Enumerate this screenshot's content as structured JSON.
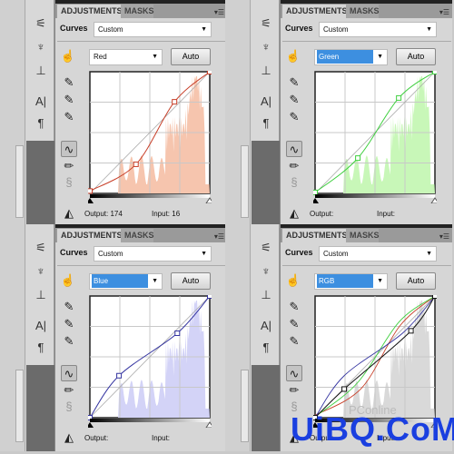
{
  "tabs": {
    "adjustments": "ADJUSTMENTS",
    "masks": "MASKS"
  },
  "curves_label": "Curves",
  "preset": "Custom",
  "auto_label": "Auto",
  "output_label": "Output:",
  "input_label": "Input:",
  "panels": [
    {
      "channel": "Red",
      "channel_selected": false,
      "curve_color": "#c8402a",
      "hist_color": "#f6c5ae",
      "output": "174",
      "input": "16",
      "points": [
        [
          0,
          5
        ],
        [
          98,
          61
        ],
        [
          180,
          192
        ],
        [
          255,
          255
        ]
      ]
    },
    {
      "channel": "Green",
      "channel_selected": true,
      "curve_color": "#3fcf3f",
      "hist_color": "#c8f7b8",
      "output": "",
      "input": "",
      "points": [
        [
          0,
          2
        ],
        [
          91,
          74
        ],
        [
          178,
          200
        ],
        [
          255,
          255
        ]
      ]
    },
    {
      "channel": "Blue",
      "channel_selected": true,
      "curve_color": "#3434a0",
      "hist_color": "#d3d3f7",
      "output": "",
      "input": "",
      "points": [
        [
          0,
          0
        ],
        [
          62,
          88
        ],
        [
          186,
          177
        ],
        [
          255,
          255
        ]
      ]
    },
    {
      "channel": "RGB",
      "channel_selected": true,
      "curve_color": "#111111",
      "hist_color": "#d9d9d9",
      "output": "",
      "input": "",
      "points": [
        [
          0,
          0
        ],
        [
          62,
          60
        ],
        [
          204,
          182
        ],
        [
          255,
          255
        ]
      ],
      "overlay": [
        [
          "#c8402a",
          [
            [
              0,
              5
            ],
            [
              98,
              61
            ],
            [
              180,
              192
            ],
            [
              255,
              255
            ]
          ]
        ],
        [
          "#3fcf3f",
          [
            [
              0,
              2
            ],
            [
              91,
              74
            ],
            [
              178,
              200
            ],
            [
              255,
              255
            ]
          ]
        ],
        [
          "#3434a0",
          [
            [
              0,
              0
            ],
            [
              62,
              88
            ],
            [
              186,
              177
            ],
            [
              255,
              255
            ]
          ]
        ]
      ]
    }
  ],
  "watermark": "UiBQ.CoM",
  "watermark_small": "PConline"
}
